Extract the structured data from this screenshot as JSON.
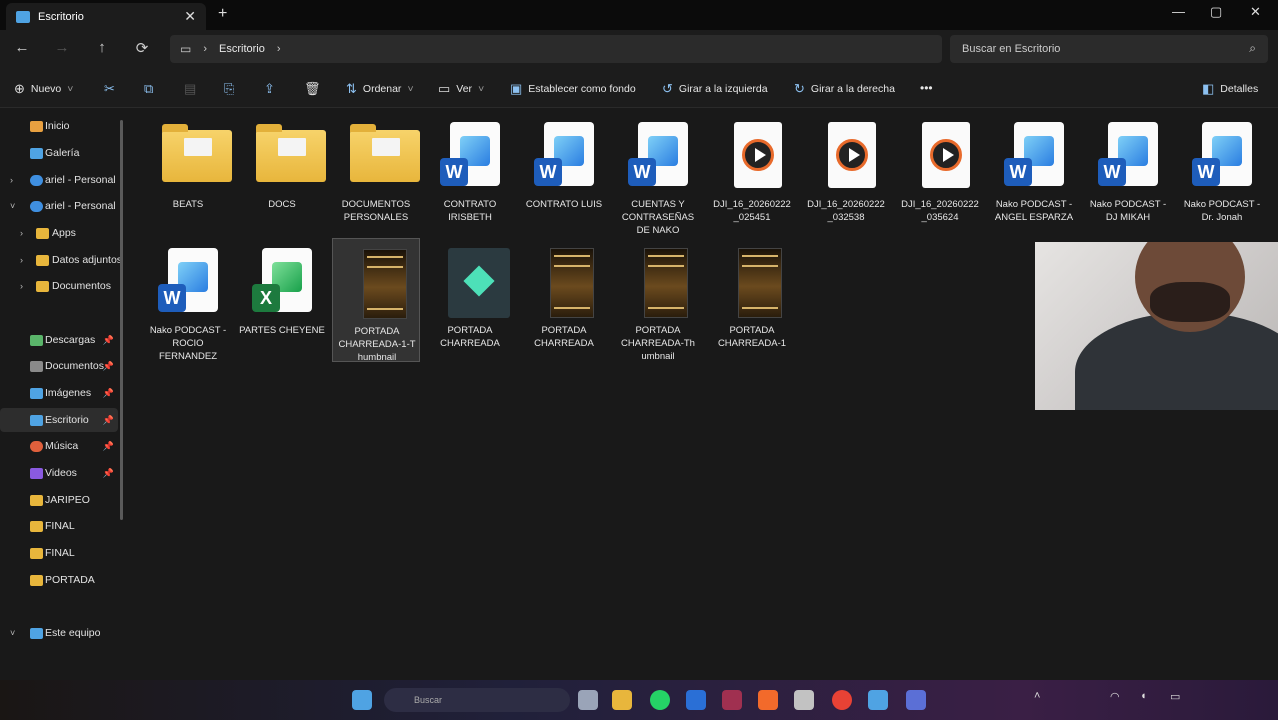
{
  "window": {
    "tab_title": "Escritorio",
    "tab_close": "✕",
    "new_tab": "+",
    "minimize": "—",
    "maximize": "▢",
    "close": "✕"
  },
  "nav": {
    "back": "←",
    "forward": "→",
    "up": "↑",
    "refresh": "⟳",
    "breadcrumb": "Escritorio",
    "search_placeholder": "Buscar en Escritorio"
  },
  "toolbar": {
    "new_label": "Nuevo",
    "sort_label": "Ordenar",
    "view_label": "Ver",
    "set_background": "Establecer como fondo",
    "rotate_left": "Girar a la izquierda",
    "rotate_right": "Girar a la derecha",
    "more": "•••",
    "details": "Detalles"
  },
  "sidebar": {
    "items": [
      {
        "label": "Inicio",
        "color": "#e8a040"
      },
      {
        "label": "Galería",
        "color": "#4fa3e3"
      },
      {
        "label": "ariel - Personal",
        "color": "#3f8fe0"
      },
      {
        "label": "ariel - Personal",
        "color": "#3f8fe0"
      },
      {
        "label": "Apps",
        "color": "#e8b63c"
      },
      {
        "label": "Datos adjuntos",
        "color": "#e8b63c"
      },
      {
        "label": "Documentos",
        "color": "#e8b63c"
      },
      {
        "label": "Descargas",
        "color": "#5ab56a"
      },
      {
        "label": "Documentos",
        "color": "#8a8a8a"
      },
      {
        "label": "Imágenes",
        "color": "#4fa3e3"
      },
      {
        "label": "Escritorio",
        "color": "#4fa3e3"
      },
      {
        "label": "Música",
        "color": "#e0603c"
      },
      {
        "label": "Videos",
        "color": "#8a5ae0"
      },
      {
        "label": "JARIPEO",
        "color": "#e8b63c"
      },
      {
        "label": "FINAL",
        "color": "#e8b63c"
      },
      {
        "label": "FINAL",
        "color": "#e8b63c"
      },
      {
        "label": "PORTADA",
        "color": "#e8b63c"
      },
      {
        "label": "Este equipo",
        "color": "#4fa3e3"
      }
    ]
  },
  "files": [
    {
      "name": "BEATS",
      "type": "folder"
    },
    {
      "name": "DOCS",
      "type": "folder"
    },
    {
      "name": "DOCUMENTOS PERSONALES",
      "type": "folder"
    },
    {
      "name": "CONTRATO IRISBETH",
      "type": "word"
    },
    {
      "name": "CONTRATO LUIS",
      "type": "word"
    },
    {
      "name": "CUENTAS Y CONTRASEÑAS DE NAKO",
      "type": "word"
    },
    {
      "name": "DJI_16_20260222 _025451",
      "type": "video"
    },
    {
      "name": "DJI_16_20260222 _032538",
      "type": "video"
    },
    {
      "name": "DJI_16_20260222 _035624",
      "type": "video"
    },
    {
      "name": "Nako PODCAST - ANGEL ESPARZA",
      "type": "word"
    },
    {
      "name": "Nako PODCAST - DJ MIKAH",
      "type": "word"
    },
    {
      "name": "Nako PODCAST - Dr. Jonah",
      "type": "word"
    },
    {
      "name": "Nako PODCAST - ROCIO FERNANDEZ",
      "type": "word"
    },
    {
      "name": "PARTES CHEYENE",
      "type": "excel"
    },
    {
      "name": "PORTADA CHARREADA-1-T humbnail",
      "type": "image"
    },
    {
      "name": "PORTADA CHARREADA",
      "type": "filmora"
    },
    {
      "name": "PORTADA CHARREADA",
      "type": "image"
    },
    {
      "name": "PORTADA CHARREADA-Th umbnail",
      "type": "image"
    },
    {
      "name": "PORTADA CHARREADA-1",
      "type": "image"
    }
  ],
  "taskbar": {
    "search_label": "Buscar"
  }
}
